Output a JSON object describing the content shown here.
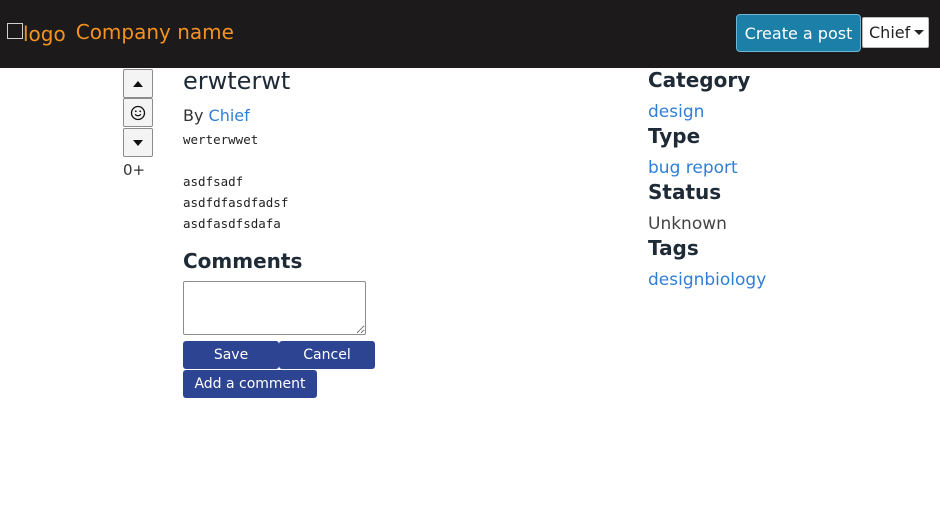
{
  "header": {
    "logo_alt": "logo",
    "company_name": "Company name",
    "create_post_label": "Create a post",
    "user_menu_label": "Chief"
  },
  "vote": {
    "count": "0+"
  },
  "post": {
    "title": "erwterwt",
    "by_prefix": "By",
    "author": "Chief",
    "body": "werterwwet\n\nasdfsadf\nasdfdfasdfadsf\nasdfasdfsdafa"
  },
  "comments": {
    "heading": "Comments",
    "textarea_value": "",
    "save_label": "Save",
    "cancel_label": "Cancel",
    "add_comment_label": "Add a comment"
  },
  "sidebar": {
    "category_heading": "Category",
    "category_value": "design",
    "type_heading": "Type",
    "type_value": "bug report",
    "status_heading": "Status",
    "status_value": "Unknown",
    "tags_heading": "Tags",
    "tags_value": "designbiology"
  },
  "colors": {
    "navbar_bg": "#1d1a1c",
    "brand": "#f39220",
    "create_button": "#1b7fa8",
    "primary_button": "#2c4491",
    "link": "#2f7fd6"
  },
  "icons": {
    "upvote": "triangle-up-icon",
    "reaction": "smiley-icon",
    "downvote": "triangle-down-icon",
    "user_menu_caret": "caret-down-icon"
  }
}
